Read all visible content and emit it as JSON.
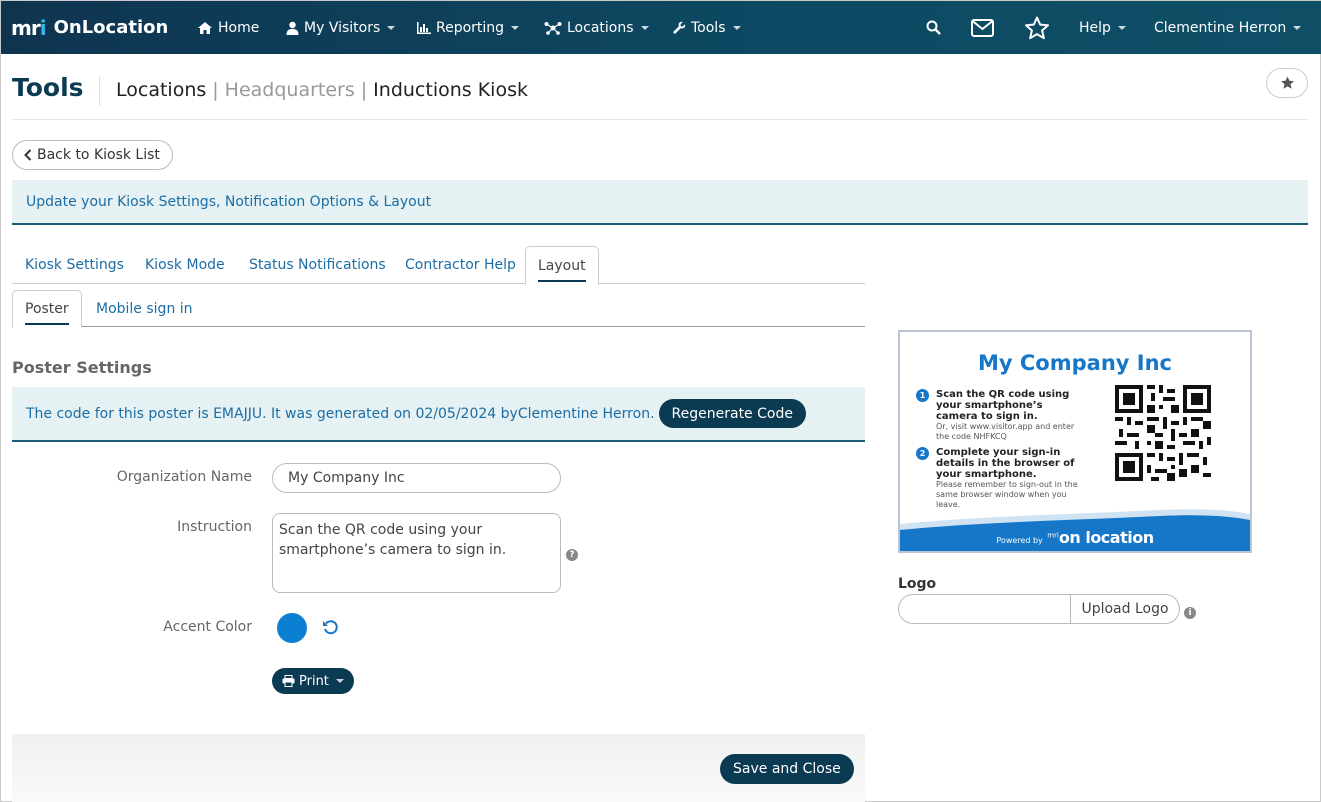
{
  "brand": {
    "logo_text_m": "m",
    "logo_text_r": "r",
    "logo_text_i": "i",
    "name": "OnLocation"
  },
  "nav": {
    "home": "Home",
    "visitors": "My Visitors",
    "reporting": "Reporting",
    "locations": "Locations",
    "tools": "Tools",
    "help": "Help",
    "user": "Clementine Herron"
  },
  "header": {
    "title": "Tools",
    "crumb1": "Locations",
    "crumb2": "Headquarters",
    "crumb3": "Inductions Kiosk",
    "separator": "|"
  },
  "back_button": "Back to Kiosk List",
  "info_banner": "Update your Kiosk Settings, Notification Options & Layout",
  "tabs": [
    "Kiosk Settings",
    "Kiosk Mode",
    "Status Notifications",
    "Contractor Help",
    "Layout"
  ],
  "subtabs": [
    "Poster",
    "Mobile sign in"
  ],
  "poster_settings": {
    "title": "Poster Settings",
    "code_text_before": "The code for this poster is EMAJJU. It was generated on 02/05/2024 by ",
    "code_user": "Clementine Herron",
    "code_text_after": ".",
    "regenerate_label": "Regenerate Code"
  },
  "form": {
    "org_label": "Organization Name",
    "org_value": "My Company Inc",
    "instruction_label": "Instruction",
    "instruction_value": "Scan the QR code using your smartphone’s camera to sign in.",
    "accent_label": "Accent Color",
    "accent_color": "#0b7fd1",
    "print_label": "Print"
  },
  "save_label": "Save and Close",
  "poster": {
    "title": "My Company Inc",
    "step1_num": "1",
    "step1_title": "Scan the QR code using your smartphone’s camera to sign in.",
    "step1_sub": "Or, visit www.visitor.app and enter the code NHFKCQ",
    "step2_num": "2",
    "step2_title": "Complete your sign-in details in the browser of your smartphone.",
    "step2_sub": "Please remember to sign-out in the same browser window when you leave.",
    "powered_by": "Powered by",
    "footer_logo": "on location",
    "footer_logo_small": "mri"
  },
  "logo": {
    "label": "Logo",
    "input_value": "",
    "upload_label": "Upload Logo"
  },
  "colors": {
    "nav_bg": "#0f3450",
    "accent": "#1676c8",
    "link": "#1b6ea5",
    "button": "#0b3a53"
  }
}
